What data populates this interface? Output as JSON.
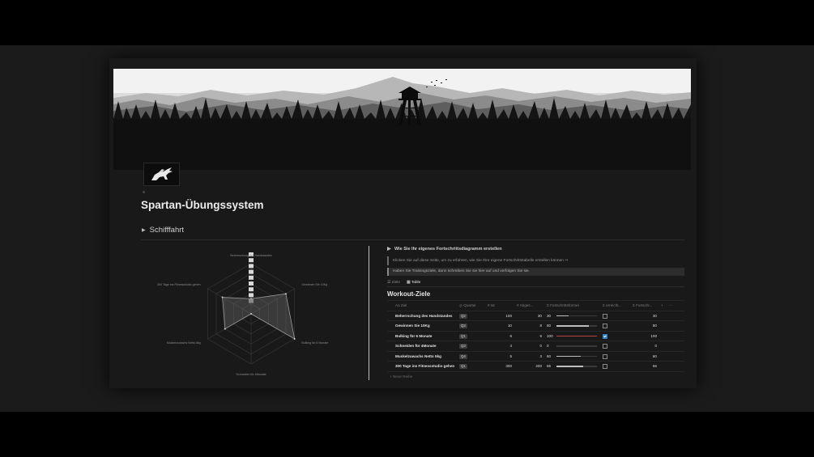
{
  "page": {
    "title": "Spartan-Übungssystem",
    "toggle_label": "Schifffahrt"
  },
  "callout": {
    "heading": "Wie Sie Ihr eigenes Fortschrittsdiagramm erstellen",
    "line1": "Klicken Sie auf diese Seite, um zu erfahren, wie Sie Ihre eigene Fortschrittstabelle erstellen können ⇒",
    "line2": "Haben Sie Trainingsziele, dann schreiben Sie sie hier auf und verfolgen Sie sie."
  },
  "tabs": [
    {
      "label": "Ziele",
      "icon": "gantt-icon",
      "active": false
    },
    {
      "label": "Table",
      "icon": "table-icon",
      "active": true
    }
  ],
  "database": {
    "title": "Workout-Ziele",
    "columns": {
      "name": "Aa Ziel",
      "quarter": "Quartal",
      "ist": "# Ist",
      "abg": "# Abges...",
      "formula": "Σ Fortschrittsformel",
      "erreicht": "Σ erreicht...",
      "fort": "Σ Fortschr...",
      "add": "+",
      "more": "···"
    },
    "rows": [
      {
        "name": "Beherrschung des Handstandes",
        "quarter": "Q2",
        "ist": "100",
        "abg": "30",
        "formula": "30",
        "progress": 0.3,
        "checked": false,
        "fort": "30"
      },
      {
        "name": "Gewinnen Sie 10Kg",
        "quarter": "Q2",
        "ist": "10",
        "abg": "8",
        "formula": "80",
        "progress": 0.8,
        "checked": false,
        "fort": "80"
      },
      {
        "name": "Bulking für 6 Monate",
        "quarter": "Q1",
        "ist": "6",
        "abg": "6",
        "formula": "100",
        "progress": 1.0,
        "checked": true,
        "fort": "100"
      },
      {
        "name": "Schneiden für 4Monate",
        "quarter": "Q3",
        "ist": "4",
        "abg": "0",
        "formula": "0",
        "progress": 0.0,
        "checked": false,
        "fort": "0"
      },
      {
        "name": "Muskelzuwachs Netto 5kg",
        "quarter": "Q4",
        "ist": "5",
        "abg": "3",
        "formula": "60",
        "progress": 0.6,
        "checked": false,
        "fort": "60"
      },
      {
        "name": "300 Tage ins Fitnessstudio gehen",
        "quarter": "Q1",
        "ist": "300",
        "abg": "200",
        "formula": "66",
        "progress": 0.66,
        "checked": false,
        "fort": "66"
      }
    ],
    "new_row": "+ Neue Reihe"
  },
  "radar": {
    "labels": [
      "Beherrschung des Handstandes",
      "Gewinnen Sie 10Kg",
      "Bulking für 6 Monate",
      "Schneiden für 4Monate",
      "Muskelzuwachs Netto 5kg",
      "300 Tage ins Fitnessstudio gehen"
    ],
    "values": [
      30,
      80,
      100,
      0,
      60,
      66
    ],
    "max": 100
  },
  "colors": {
    "accent_red": "#b8433e",
    "checkbox_blue": "#2f7fc9"
  }
}
